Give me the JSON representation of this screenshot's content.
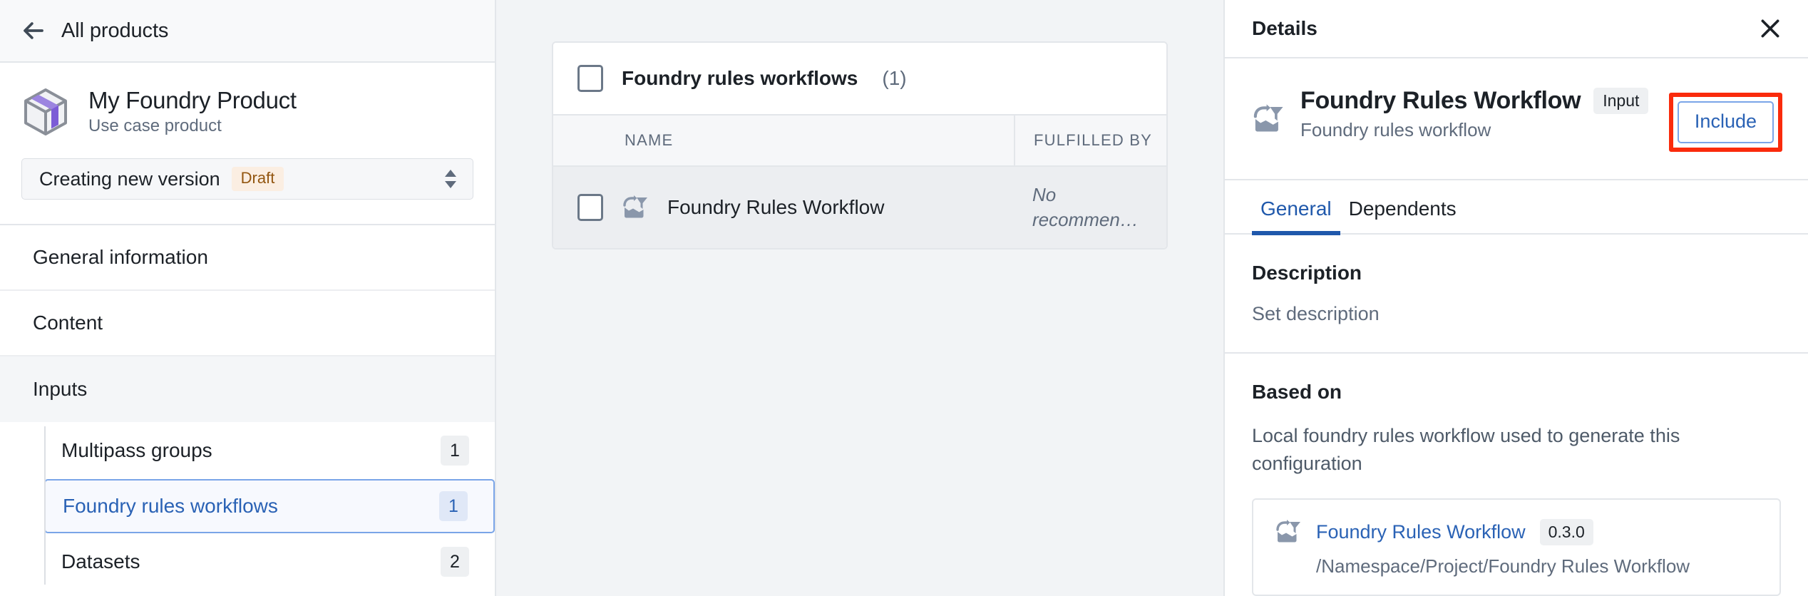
{
  "sidebar": {
    "back_label": "All products",
    "product": {
      "title": "My Foundry Product",
      "subtitle": "Use case product",
      "icon": "cube-package-icon"
    },
    "version_selector": {
      "label": "Creating new version",
      "status_badge": "Draft",
      "badge_color": "#935610",
      "badge_bg": "#fbeee2"
    },
    "nav": [
      {
        "label": "General information",
        "type": "section",
        "active": false
      },
      {
        "label": "Content",
        "type": "section",
        "active": false
      },
      {
        "label": "Inputs",
        "type": "section",
        "active": true
      }
    ],
    "children": [
      {
        "label": "Multipass groups",
        "count": "1",
        "selected": false
      },
      {
        "label": "Foundry rules workflows",
        "count": "1",
        "selected": true
      },
      {
        "label": "Datasets",
        "count": "2",
        "selected": false
      }
    ]
  },
  "center": {
    "card": {
      "title": "Foundry rules workflows",
      "count": "(1)",
      "columns": [
        "NAME",
        "FULFILLED BY"
      ],
      "rows": [
        {
          "name": "Foundry Rules Workflow",
          "icon": "foundry-rules-workflow-icon",
          "fulfilled_by": "No recommen…"
        }
      ]
    }
  },
  "details": {
    "panel_title": "Details",
    "close_icon": "close-icon",
    "entity": {
      "icon": "foundry-rules-workflow-icon",
      "title": "Foundry Rules Workflow",
      "type_badge": "Input",
      "subtitle": "Foundry rules workflow",
      "include_button": "Include",
      "highlight_color": "#fa2b0c"
    },
    "tabs": [
      {
        "label": "General",
        "active": true
      },
      {
        "label": "Dependents",
        "active": false
      }
    ],
    "description": {
      "heading": "Description",
      "value": "Set description"
    },
    "based_on": {
      "heading": "Based on",
      "text": "Local foundry rules workflow used to generate this configuration",
      "item": {
        "name": "Foundry Rules Workflow",
        "version": "0.3.0",
        "path": "/Namespace/Project/Foundry Rules Workflow"
      }
    }
  },
  "colors": {
    "accent_blue": "#2a62b5",
    "tab_underline": "#1f58ab",
    "panel_border": "#e3e6ea",
    "center_bg": "#f2f4f6",
    "row_bg": "#eceef1"
  }
}
